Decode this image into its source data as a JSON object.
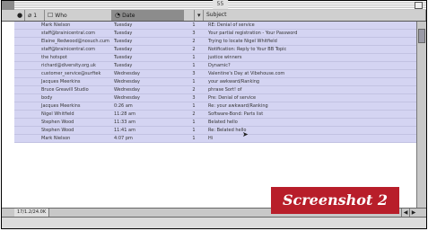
{
  "window": {
    "title": "55"
  },
  "columns": {
    "status": "",
    "attachments": "1",
    "from": "Who",
    "date": "Date",
    "count": "",
    "subject": "Subject"
  },
  "messages": [
    {
      "flag": "",
      "from": "Mark Nielson",
      "date": "Tuesday",
      "count": "1",
      "mark": "",
      "subject": "RE: Denial of service"
    },
    {
      "flag": "",
      "from": "staff@brainicentral.com",
      "date": "Tuesday",
      "count": "3",
      "mark": "",
      "subject": "Your partial registration - Your Password"
    },
    {
      "flag": "",
      "from": "Elaine_Redwood@nosuch.cum",
      "date": "Tuesday",
      "count": "2",
      "mark": "",
      "subject": "Trying to locate Nigel Whitfield"
    },
    {
      "flag": "",
      "from": "staff@brainicentral.com",
      "date": "Tuesday",
      "count": "2",
      "mark": "",
      "subject": "Notification: Reply to Your BB Topic"
    },
    {
      "flag": "",
      "from": "the hotspot",
      "date": "Tuesday",
      "count": "1",
      "mark": "",
      "subject": "justice winners"
    },
    {
      "flag": "",
      "from": "richard@diversity.org.uk",
      "date": "Tuesday",
      "count": "1",
      "mark": "",
      "subject": "Dynamic?"
    },
    {
      "flag": "",
      "from": "customer_service@surftek",
      "date": "Wednesday",
      "count": "3",
      "mark": "",
      "subject": "Valentine's Day at Vibehouse.com"
    },
    {
      "flag": "",
      "from": "Jacques Meerkins",
      "date": "Wednesday",
      "count": "1",
      "mark": "",
      "subject": "your awkward/Ranking"
    },
    {
      "flag": "",
      "from": "Bruce Greavill Studio",
      "date": "Wednesday",
      "count": "2",
      "mark": "",
      "subject": "phrase Sort! of"
    },
    {
      "flag": "",
      "from": "body",
      "date": "Wednesday",
      "count": "3",
      "mark": "",
      "subject": "Pre: Denial of service"
    },
    {
      "flag": "",
      "from": "Jacques Meerkins",
      "date": "0:26 am",
      "count": "1",
      "mark": "",
      "subject": "Re: your awkward/Ranking"
    },
    {
      "flag": "",
      "from": "Nigel Whitfield",
      "date": "11:28 am",
      "count": "2",
      "mark": "",
      "subject": "Software-Bond: Parts list"
    },
    {
      "flag": "",
      "from": "Stephen Wood",
      "date": "11:33 am",
      "count": "1",
      "mark": "",
      "subject": "Belated hello"
    },
    {
      "flag": "",
      "from": "Stephen Wood",
      "date": "11:41 am",
      "count": "1",
      "mark": "",
      "subject": "Re: Belated hello"
    },
    {
      "flag": "",
      "from": "Mark Nielson",
      "date": "4:07 pm",
      "count": "1",
      "mark": "",
      "subject": "Hi"
    }
  ],
  "status_bar": {
    "text": "17/1.2/24.0K",
    "arrow_left": "◀",
    "arrow_right": "▶"
  },
  "badge": {
    "label": "Screenshot 2"
  },
  "colors": {
    "row": "#d4d4f2",
    "accent_badge": "#b81e2a",
    "header": "#cfcfcf"
  }
}
